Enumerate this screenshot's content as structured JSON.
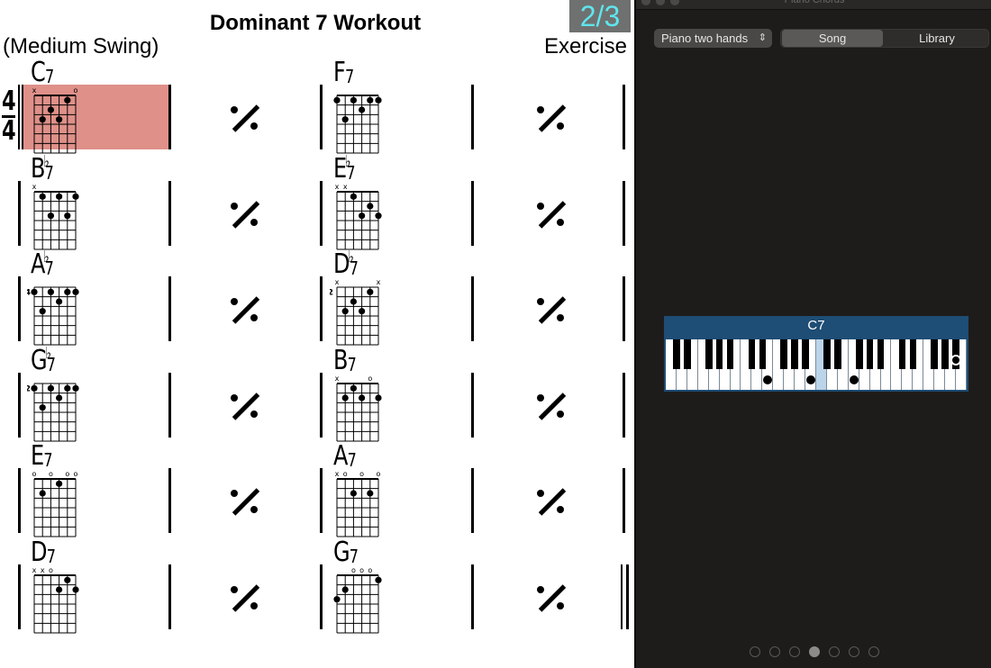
{
  "sheet": {
    "title": "Dominant 7 Workout",
    "style": "(Medium Swing)",
    "composer": "Exercise",
    "page_indicator": "2/3",
    "time_signature": {
      "top": "4",
      "bottom": "4"
    },
    "highlight_color": "#de9089",
    "repeat_symbol": "measure-repeat",
    "rows": [
      {
        "chords": [
          {
            "root": "C",
            "acc": "",
            "quality": "7",
            "base_fret": "",
            "markers": [
              "x",
              "",
              "",
              "",
              "",
              "o"
            ],
            "dots": [
              [
                2,
                3
              ],
              [
                3,
                2
              ],
              [
                4,
                3
              ],
              [
                5,
                1
              ]
            ]
          },
          {
            "root": "F",
            "acc": "",
            "quality": "7",
            "base_fret": "",
            "markers": [
              "",
              "",
              "",
              "",
              "",
              ""
            ],
            "dots": [
              [
                1,
                1
              ],
              [
                2,
                3
              ],
              [
                3,
                1
              ],
              [
                4,
                2
              ],
              [
                5,
                1
              ],
              [
                6,
                1
              ]
            ]
          }
        ]
      },
      {
        "chords": [
          {
            "root": "B",
            "acc": "♭",
            "quality": "7",
            "base_fret": "",
            "markers": [
              "x",
              "",
              "",
              "",
              "",
              ""
            ],
            "dots": [
              [
                2,
                1
              ],
              [
                3,
                3
              ],
              [
                4,
                1
              ],
              [
                5,
                3
              ],
              [
                6,
                1
              ]
            ]
          },
          {
            "root": "E",
            "acc": "♭",
            "quality": "7",
            "base_fret": "",
            "markers": [
              "x",
              "x",
              "",
              "",
              "",
              ""
            ],
            "dots": [
              [
                3,
                1
              ],
              [
                4,
                3
              ],
              [
                5,
                2
              ],
              [
                6,
                3
              ]
            ]
          }
        ]
      },
      {
        "chords": [
          {
            "root": "A",
            "acc": "♭",
            "quality": "7",
            "base_fret": "4",
            "markers": [
              "",
              "",
              "",
              "",
              "",
              ""
            ],
            "dots": [
              [
                1,
                1
              ],
              [
                2,
                3
              ],
              [
                3,
                1
              ],
              [
                4,
                2
              ],
              [
                5,
                1
              ],
              [
                6,
                1
              ]
            ]
          },
          {
            "root": "D",
            "acc": "♭",
            "quality": "7",
            "base_fret": "2",
            "markers": [
              "x",
              "",
              "",
              "",
              "",
              "x"
            ],
            "dots": [
              [
                2,
                3
              ],
              [
                3,
                2
              ],
              [
                4,
                3
              ],
              [
                5,
                1
              ]
            ]
          }
        ]
      },
      {
        "chords": [
          {
            "root": "G",
            "acc": "♭",
            "quality": "7",
            "base_fret": "2",
            "markers": [
              "",
              "",
              "",
              "",
              "",
              ""
            ],
            "dots": [
              [
                1,
                1
              ],
              [
                2,
                3
              ],
              [
                3,
                1
              ],
              [
                4,
                2
              ],
              [
                5,
                1
              ],
              [
                6,
                1
              ]
            ]
          },
          {
            "root": "B",
            "acc": "",
            "quality": "7",
            "base_fret": "",
            "markers": [
              "x",
              "",
              "",
              "",
              "o",
              ""
            ],
            "dots": [
              [
                2,
                2
              ],
              [
                3,
                1
              ],
              [
                4,
                2
              ],
              [
                6,
                2
              ]
            ]
          }
        ]
      },
      {
        "chords": [
          {
            "root": "E",
            "acc": "",
            "quality": "7",
            "base_fret": "",
            "markers": [
              "o",
              "",
              "o",
              "",
              "o",
              "o"
            ],
            "dots": [
              [
                2,
                2
              ],
              [
                4,
                1
              ]
            ]
          },
          {
            "root": "A",
            "acc": "",
            "quality": "7",
            "base_fret": "",
            "markers": [
              "x",
              "o",
              "",
              "o",
              "",
              "o"
            ],
            "dots": [
              [
                3,
                2
              ],
              [
                5,
                2
              ]
            ]
          }
        ]
      },
      {
        "chords": [
          {
            "root": "D",
            "acc": "",
            "quality": "7",
            "base_fret": "",
            "markers": [
              "x",
              "x",
              "o",
              "",
              "",
              ""
            ],
            "dots": [
              [
                4,
                2
              ],
              [
                5,
                1
              ],
              [
                6,
                2
              ]
            ]
          },
          {
            "root": "G",
            "acc": "",
            "quality": "7",
            "base_fret": "",
            "markers": [
              "",
              "",
              "o",
              "o",
              "o",
              ""
            ],
            "dots": [
              [
                1,
                3
              ],
              [
                2,
                2
              ],
              [
                6,
                1
              ]
            ]
          }
        ]
      }
    ]
  },
  "panel": {
    "window_title": "Piano Chords",
    "instrument_select": "Piano two hands",
    "segments": [
      {
        "label": "Song",
        "active": true
      },
      {
        "label": "Library",
        "active": false
      }
    ],
    "keyboard": {
      "chord_label": "C7",
      "header_color": "#1e4d75",
      "octaves": 4,
      "highlighted_white_key": 14,
      "notes": [
        {
          "type": "white",
          "index": 9,
          "label": "E"
        },
        {
          "type": "white",
          "index": 13,
          "label": "B♭"
        },
        {
          "type": "white",
          "index": 17,
          "label": "G"
        },
        {
          "type": "black",
          "index": 20,
          "open": true,
          "label": "B♭"
        }
      ]
    },
    "page_dots": {
      "count": 7,
      "active": 3
    }
  }
}
